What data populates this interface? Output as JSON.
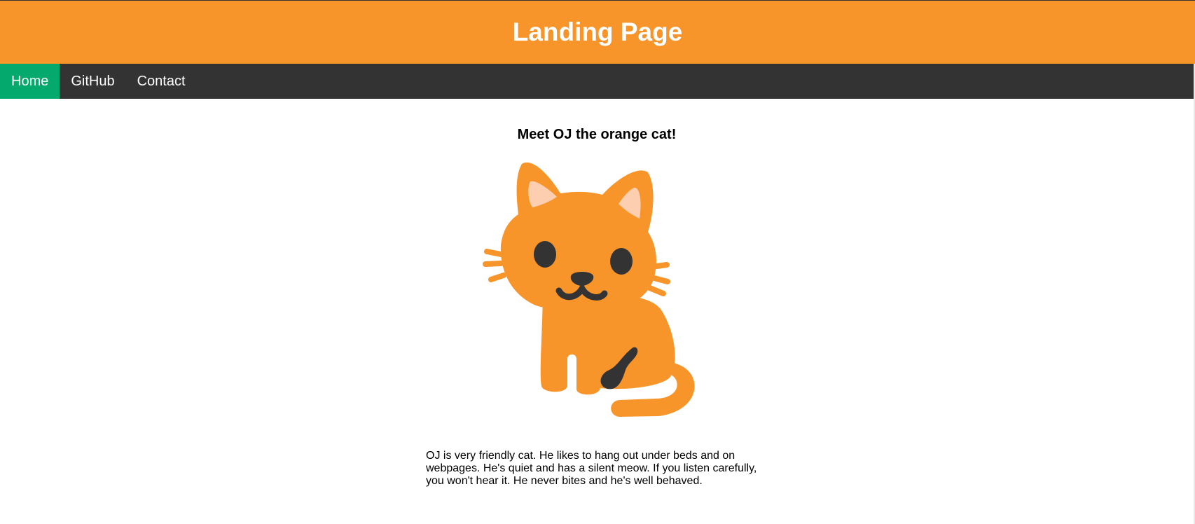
{
  "header": {
    "title": "Landing Page"
  },
  "nav": {
    "items": [
      {
        "label": "Home",
        "active": true
      },
      {
        "label": "GitHub",
        "active": false
      },
      {
        "label": "Contact",
        "active": false
      }
    ]
  },
  "main": {
    "heading": "Meet OJ the orange cat!",
    "description": "OJ is very friendly cat. He likes to hang out under beds and on webpages. He's quiet and has a silent meow. If you listen carefully, you won't hear it. He never bites and he's well behaved.",
    "image_icon": "orange-cat-icon"
  },
  "colors": {
    "header_bg": "#f7942a",
    "nav_bg": "#333333",
    "nav_active_bg": "#04aa6d",
    "cat_orange": "#f7942a",
    "cat_dark": "#333333",
    "cat_ear_inner": "#fdcfb0"
  }
}
